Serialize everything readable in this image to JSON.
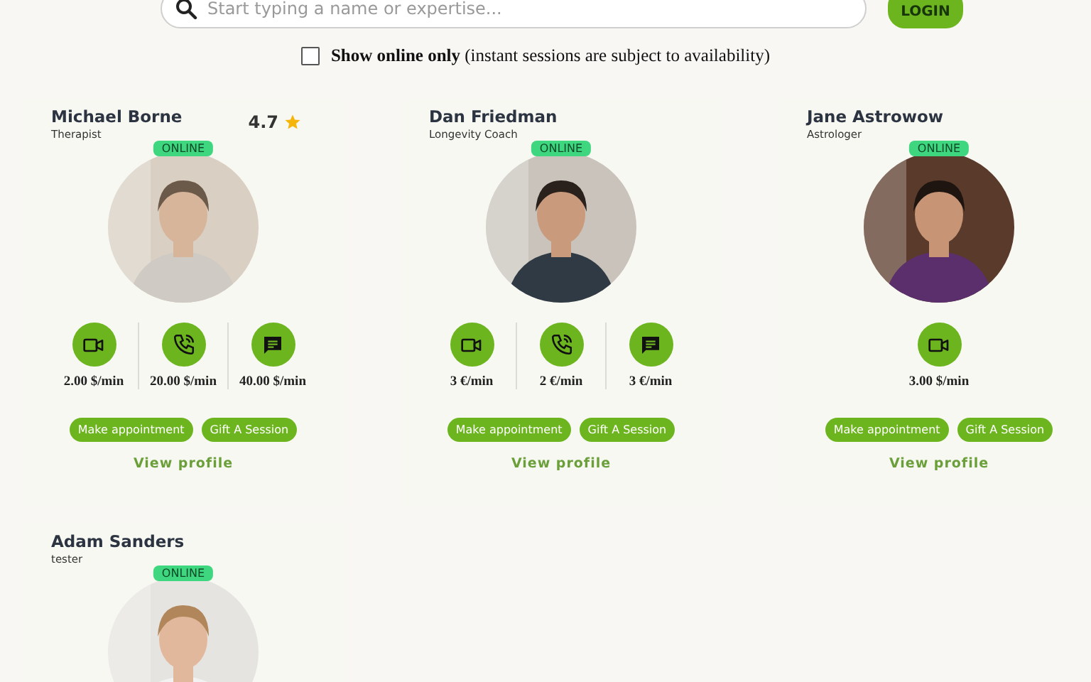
{
  "search": {
    "placeholder": "Start typing a name or expertise..."
  },
  "login_button": "LOGIN",
  "online_filter": {
    "checked": false,
    "label": "Show online only",
    "note": "(instant sessions are subject to availability)"
  },
  "experts": [
    {
      "name": "Michael Borne",
      "title": "Therapist",
      "rating": "4.7",
      "status": "ONLINE",
      "avatar": {
        "kind": "picture"
      },
      "services": [
        {
          "kind": "video",
          "price": "2.00 $/min"
        },
        {
          "kind": "phone",
          "price": "20.00 $/min"
        },
        {
          "kind": "chat",
          "price": "40.00 $/min"
        }
      ],
      "buttons": [
        "Make appointment",
        "Gift A Session"
      ],
      "link": "View profile"
    },
    {
      "name": "Dan Friedman",
      "title": "Longevity Coach",
      "status": "ONLINE",
      "avatar": {
        "kind": "picture"
      },
      "services": [
        {
          "kind": "video",
          "price": "3 €/min"
        },
        {
          "kind": "phone",
          "price": "2 €/min"
        },
        {
          "kind": "chat",
          "price": "3 €/min"
        }
      ],
      "buttons": [
        "Make appointment",
        "Gift A Session"
      ],
      "link": "View profile"
    },
    {
      "name": "Jane Astrowow",
      "title": "Astrologer",
      "status": "ONLINE",
      "avatar": {
        "kind": "picture"
      },
      "services": [
        {
          "kind": "video",
          "price": "3.00 $/min"
        }
      ],
      "buttons": [
        "Make appointment",
        "Gift A Session"
      ],
      "link": "View profile"
    },
    {
      "name": "Adam Sanders",
      "title": "tester",
      "status": "ONLINE",
      "avatar": {
        "kind": "picture"
      }
    }
  ]
}
